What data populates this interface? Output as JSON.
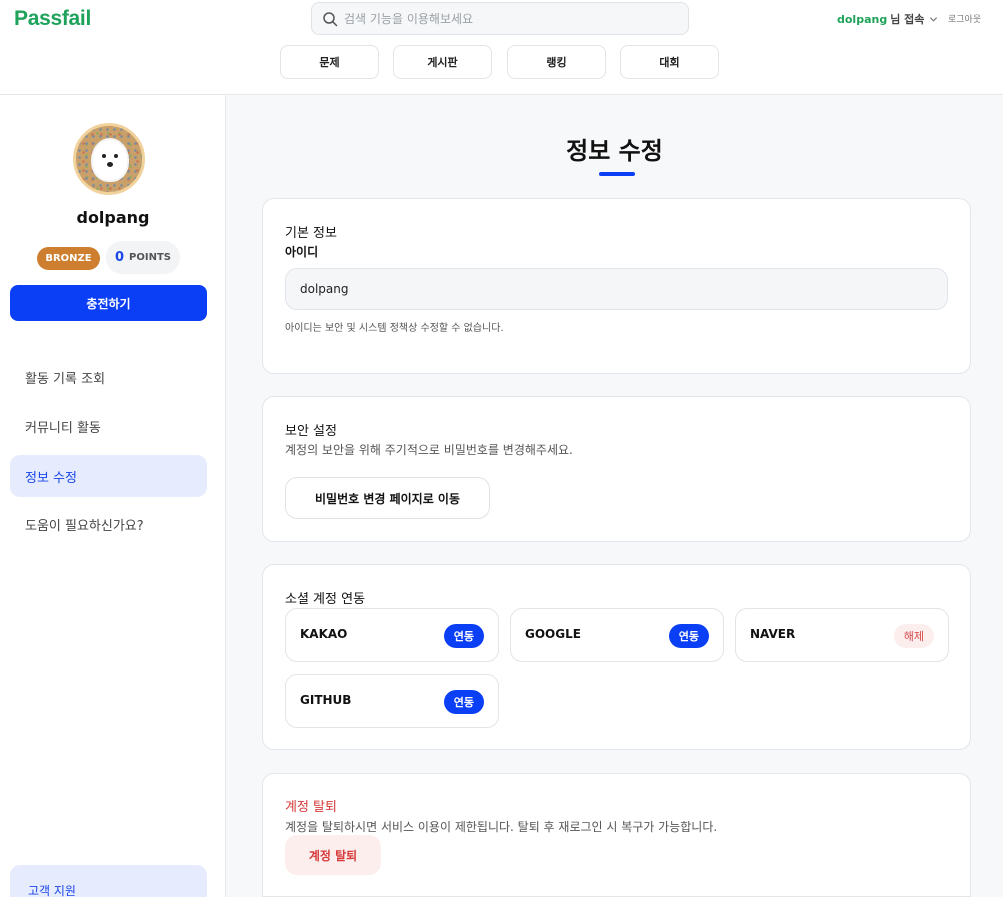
{
  "header": {
    "logo": "Passfail",
    "search_placeholder": "검색 기능을 이용해보세요",
    "user_name": "dolpang",
    "user_suffix": "님 접속",
    "logout": "로그아웃",
    "nav": [
      "문제",
      "게시판",
      "랭킹",
      "대회"
    ]
  },
  "sidebar": {
    "username": "dolpang",
    "tier": "BRONZE",
    "tier_color": "#cd7e2e",
    "points_value": "0",
    "points_label": "POINTS",
    "charge_label": "충전하기",
    "menu": [
      "활동 기록 조회",
      "커뮤니티 활동",
      "정보 수정",
      "도움이 필요하신가요?"
    ],
    "active_menu": "정보 수정",
    "support_label": "고객 지원"
  },
  "main": {
    "title": "정보 수정",
    "accent_color": "#0b3ff5",
    "basic": {
      "title": "기본 정보",
      "id_label": "아이디",
      "id_value": "dolpang",
      "id_hint": "아이디는 보안 및 시스템 정책상 수정할 수 없습니다."
    },
    "security": {
      "title": "보안 설정",
      "desc": "계정의 보안을 위해 주기적으로 비밀번호를 변경해주세요.",
      "button": "비밀번호 변경 페이지로 이동"
    },
    "social": {
      "title": "소셜 계정 연동",
      "accounts": [
        {
          "name": "KAKAO",
          "status": "연동"
        },
        {
          "name": "GOOGLE",
          "status": "연동"
        },
        {
          "name": "NAVER",
          "status": "해제"
        },
        {
          "name": "GITHUB",
          "status": "연동"
        }
      ]
    },
    "withdraw": {
      "title": "계정 탈퇴",
      "desc": "계정을 탈퇴하시면 서비스 이용이 제한됩니다. 탈퇴 후 재로그인 시 복구가 가능합니다.",
      "button": "계정 탈퇴"
    }
  }
}
